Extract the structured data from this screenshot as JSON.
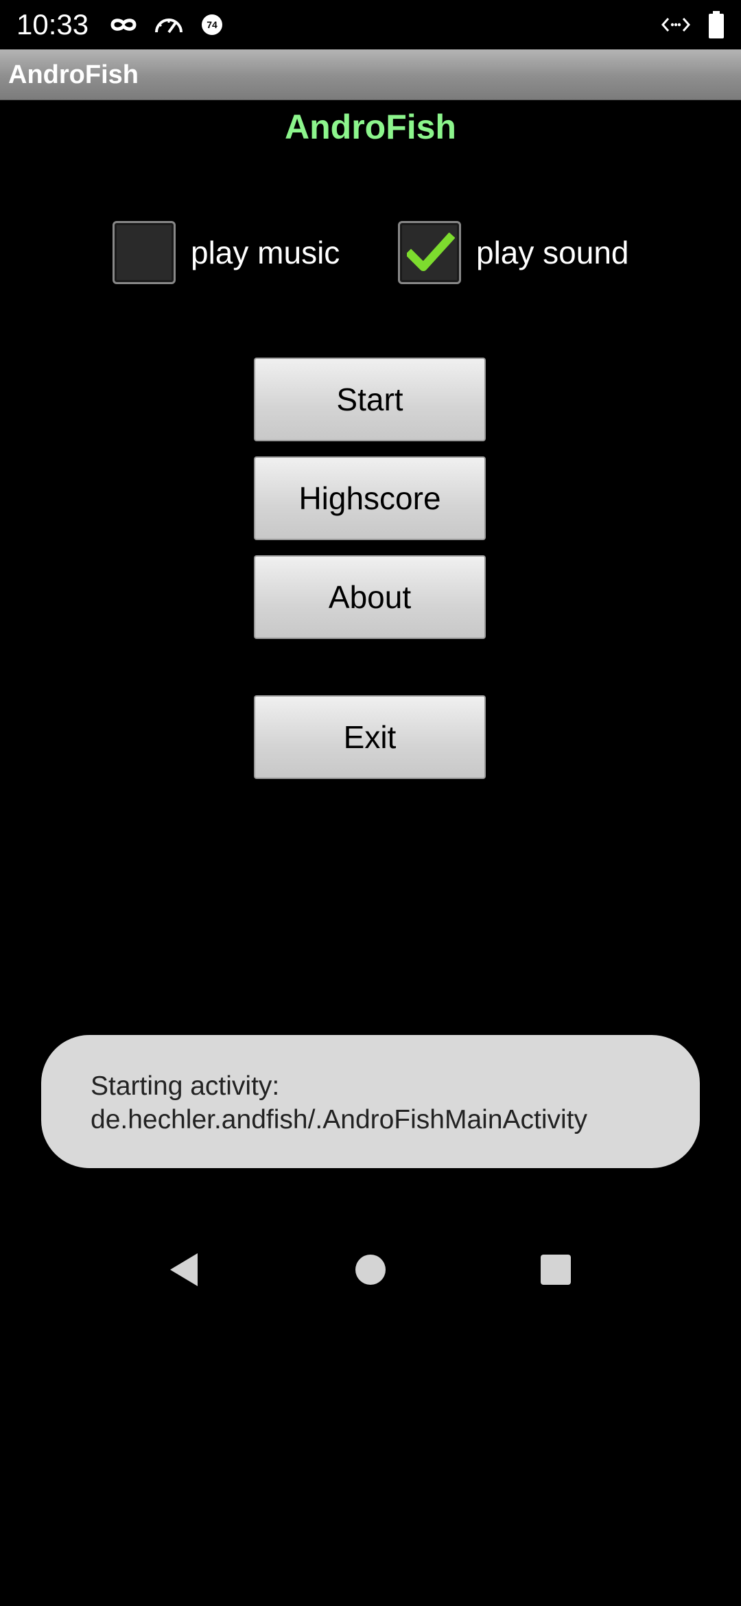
{
  "status_bar": {
    "time": "10:33",
    "icons_left": [
      "incognito-icon",
      "speedometer-icon",
      "badge-74-icon"
    ],
    "badge_number": "74",
    "icons_right": [
      "code-arrows-icon",
      "battery-icon"
    ]
  },
  "title_bar": {
    "title": "AndroFish"
  },
  "header": {
    "title": "AndroFish",
    "color": "#8cf58c"
  },
  "options": {
    "play_music": {
      "label": "play music",
      "checked": false
    },
    "play_sound": {
      "label": "play sound",
      "checked": true
    }
  },
  "menu": {
    "start_label": "Start",
    "highscore_label": "Highscore",
    "about_label": "About",
    "exit_label": "Exit"
  },
  "toast": {
    "line1": "Starting activity:",
    "line2": "de.hechler.andfish/.AndroFishMainActivity"
  },
  "nav_bar": {
    "icons": [
      "back-icon",
      "home-icon",
      "recents-icon"
    ]
  },
  "colors": {
    "checkmark": "#7ddc2e",
    "toast_background": "#d9d9d9"
  }
}
